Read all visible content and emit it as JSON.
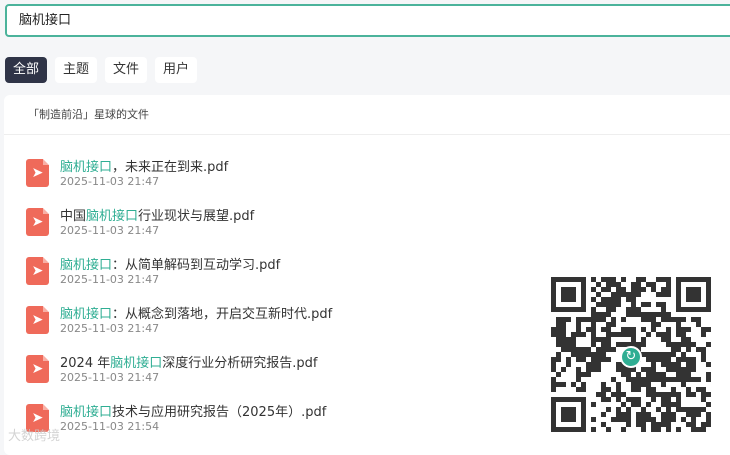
{
  "search": {
    "value": "脑机接口"
  },
  "tabs": [
    {
      "label": "全部",
      "active": true
    },
    {
      "label": "主题"
    },
    {
      "label": "文件"
    },
    {
      "label": "用户"
    }
  ],
  "section_title": "「制造前沿」星球的文件",
  "files": [
    {
      "pre": "",
      "hl": "脑机接口",
      "post": "，未来正在到来.pdf",
      "time": "2025-11-03 21:47"
    },
    {
      "pre": "中国",
      "hl": "脑机接口",
      "post": "行业现状与展望.pdf",
      "time": "2025-11-03 21:47"
    },
    {
      "pre": "",
      "hl": "脑机接口",
      "post": "：从简单解码到互动学习.pdf",
      "time": "2025-11-03 21:47"
    },
    {
      "pre": "",
      "hl": "脑机接口",
      "post": "：从概念到落地，开启交互新时代.pdf",
      "time": "2025-11-03 21:47"
    },
    {
      "pre": "2024 年",
      "hl": "脑机接口",
      "post": "深度行业分析研究报告.pdf",
      "time": "2025-11-03 21:47"
    },
    {
      "pre": "",
      "hl": "脑机接口",
      "post": "技术与应用研究报告（2025年）.pdf",
      "time": "2025-11-03 21:54"
    }
  ],
  "watermark": "大数跨境",
  "accent": "#2fae93"
}
